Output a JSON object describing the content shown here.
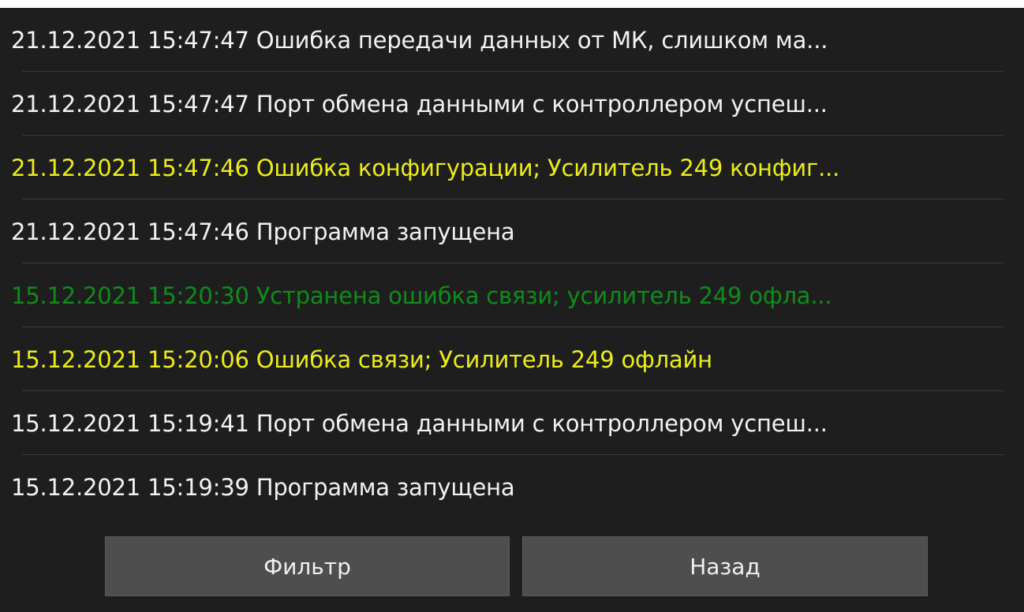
{
  "colors": {
    "background": "#1e1e1f",
    "info": "#f2f2f2",
    "warning": "#ecec1a",
    "resolved": "#0f8c1a",
    "button": "#4e4e4f"
  },
  "log": {
    "entries": [
      {
        "text": "21.12.2021 15:47:47 Ошибка передачи данных от МК, слишком ма...",
        "level": "info"
      },
      {
        "text": "21.12.2021 15:47:47 Порт обмена данными с контроллером успеш...",
        "level": "info"
      },
      {
        "text": "21.12.2021 15:47:46 Ошибка конфигурации; Усилитель 249 конфиг...",
        "level": "warn"
      },
      {
        "text": "21.12.2021 15:47:46 Программа запущена",
        "level": "info"
      },
      {
        "text": "15.12.2021 15:20:30 Устранена ошибка связи; усилитель 249 офла...",
        "level": "ok"
      },
      {
        "text": "15.12.2021 15:20:06 Ошибка связи; Усилитель 249 офлайн",
        "level": "warn"
      },
      {
        "text": "15.12.2021 15:19:41 Порт обмена данными с контроллером успеш...",
        "level": "info"
      },
      {
        "text": "15.12.2021 15:19:39 Программа запущена",
        "level": "info"
      }
    ]
  },
  "buttons": {
    "filter_label": "Фильтр",
    "back_label": "Назад"
  }
}
